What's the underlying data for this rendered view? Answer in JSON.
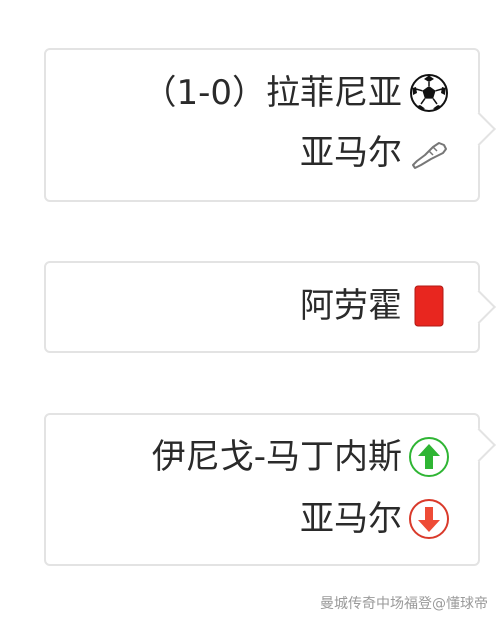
{
  "events": [
    {
      "lines": [
        {
          "text": "（1-0）拉菲尼亚",
          "icon": "goal-ball-icon"
        },
        {
          "text": "亚马尔",
          "icon": "assist-boot-icon"
        }
      ]
    },
    {
      "lines": [
        {
          "text": "阿劳霍",
          "icon": "red-card-icon"
        }
      ]
    },
    {
      "lines": [
        {
          "text": "伊尼戈-马丁内斯",
          "icon": "sub-in-arrow-icon"
        },
        {
          "text": "亚马尔",
          "icon": "sub-out-arrow-icon"
        }
      ]
    }
  ],
  "colors": {
    "red_card": "#e8261f",
    "sub_in": "#2fb534",
    "sub_out": "#d93a2b",
    "card_border": "#e3e3e3"
  },
  "watermark": "曼城传奇中场福登@懂球帝"
}
